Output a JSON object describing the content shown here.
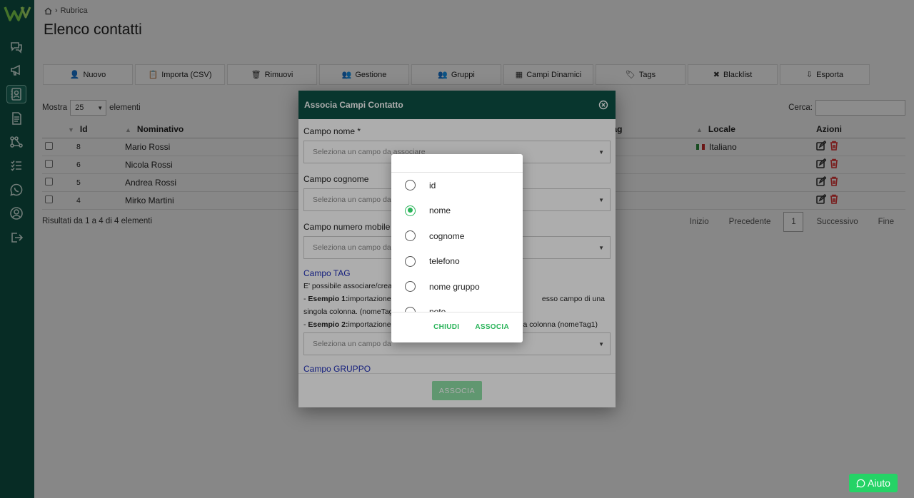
{
  "colors": {
    "brand": "#0d5044",
    "accent": "#2ab45a",
    "whatsapp": "#25d366"
  },
  "sidebar": {
    "logo": "logo-icon",
    "items": [
      {
        "icon": "chat-icon"
      },
      {
        "icon": "megaphone-icon"
      },
      {
        "icon": "contacts-icon",
        "active": true
      },
      {
        "icon": "document-icon"
      },
      {
        "icon": "network-icon"
      },
      {
        "icon": "checklist-icon"
      },
      {
        "icon": "whatsapp-icon"
      },
      {
        "icon": "user-circle-icon"
      },
      {
        "icon": "logout-icon"
      }
    ]
  },
  "breadcrumb": {
    "current": "Rubrica"
  },
  "page": {
    "title": "Elenco contatti"
  },
  "toolbar": {
    "nuovo": "Nuovo",
    "importa": "Importa (CSV)",
    "rimuovi": "Rimuovi",
    "gestione": "Gestione",
    "gruppi": "Gruppi",
    "campi": "Campi Dinamici",
    "tags": "Tags",
    "blacklist": "Blacklist",
    "esporta": "Esporta"
  },
  "table_controls": {
    "show_label": "Mostra",
    "page_size": "25",
    "elements_label": "elementi",
    "search_label": "Cerca:"
  },
  "table": {
    "columns": {
      "id": "Id",
      "nominativo": "Nominativo",
      "tag": "Tag",
      "locale": "Locale",
      "azioni": "Azioni"
    },
    "rows": [
      {
        "id": "8",
        "nome": "Mario Rossi",
        "locale": "Italiano"
      },
      {
        "id": "6",
        "nome": "Nicola Rossi",
        "locale": ""
      },
      {
        "id": "5",
        "nome": "Andrea Rossi",
        "locale": ""
      },
      {
        "id": "4",
        "nome": "Mirko Martini",
        "locale": ""
      }
    ]
  },
  "results": "Risultati da 1 a 4 di 4 elementi",
  "pager": {
    "first": "Inizio",
    "prev": "Precedente",
    "current": "1",
    "next": "Successivo",
    "last": "Fine"
  },
  "help": {
    "label": "Aiuto"
  },
  "modal": {
    "title": "Associa Campi Contatto",
    "campo_nome_label": "Campo nome *",
    "campo_nome_placeholder": "Seleziona un campo da associare",
    "campo_cognome_label": "Campo cognome",
    "campo_cognome_placeholder": "Seleziona un campo da",
    "campo_mobile_label": "Campo numero mobile",
    "campo_mobile_placeholder": "Seleziona un campo da",
    "tag_title": "Campo TAG",
    "tag_line1": "E' possibile associare/crea",
    "tag_ex1_label": "Esempio 1:",
    "tag_ex1_text": "importazione",
    "tag_ex1_tail": "esso campo di una",
    "tag_line3": "singola colonna. (nomeTag",
    "tag_ex2_label": "Esempio 2:",
    "tag_ex2_text": "importazione s",
    "tag_ex2_tail": "a colonna (nomeTag1)",
    "campo_tag_placeholder": "Seleziona un campo da",
    "gruppo_title": "Campo GRUPPO",
    "associa_button": "ASSOCIA"
  },
  "picker": {
    "options": [
      "id",
      "nome",
      "cognome",
      "telefono",
      "nome gruppo",
      "note"
    ],
    "selected": "nome",
    "close_button": "CHIUDI",
    "confirm_button": "ASSOCIA"
  }
}
